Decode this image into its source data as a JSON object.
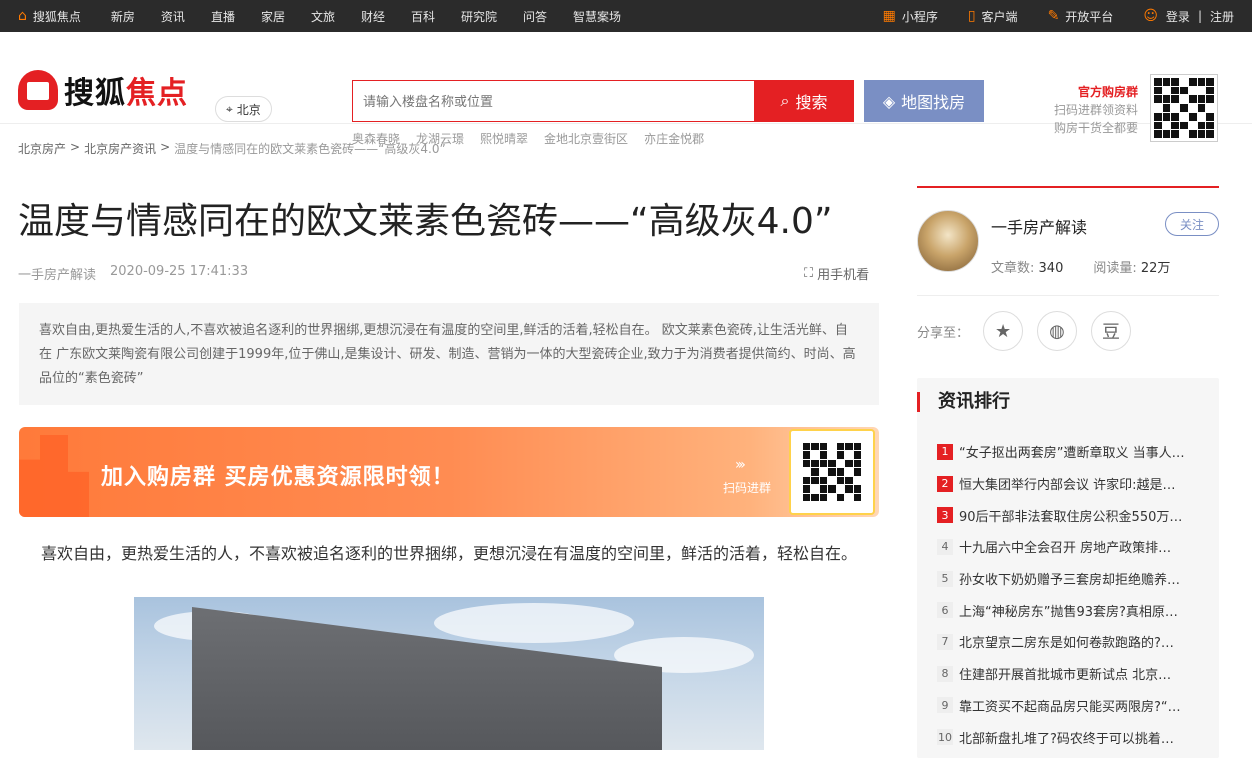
{
  "topbar": {
    "home": "搜狐焦点",
    "nav": [
      "新房",
      "资讯",
      "直播",
      "家居",
      "文旅",
      "财经",
      "百科",
      "研究院",
      "问答",
      "智慧案场"
    ],
    "mini_program": "小程序",
    "client": "客户端",
    "open_platform": "开放平台",
    "login": "登录",
    "register": "注册",
    "sep": "|"
  },
  "header": {
    "logo_a": "搜狐",
    "logo_b": "焦点",
    "city": "北京",
    "search_placeholder": "请输入楼盘名称或位置",
    "search_button": "搜索",
    "map_button": "地图找房",
    "hot_searches": [
      "奥森春晓",
      "龙湖云璟",
      "熙悦晴翠",
      "金地北京壹街区",
      "亦庄金悦郡"
    ],
    "group_title": "官方购房群",
    "group_line1": "扫码进群领资料",
    "group_line2": "购房干货全都要"
  },
  "breadcrumb": {
    "items": [
      "北京房产",
      "北京房产资讯"
    ],
    "sep": ">",
    "current": "温度与情感同在的欧文莱素色瓷砖——“高级灰4.0”"
  },
  "article": {
    "title": "温度与情感同在的欧文莱素色瓷砖——“高级灰4.0”",
    "author": "一手房产解读",
    "time": "2020-09-25 17:41:33",
    "mobile_read": "用手机看",
    "summary": "喜欢自由,更热爱生活的人,不喜欢被追名逐利的世界捆绑,更想沉浸在有温度的空间里,鲜活的活着,轻松自在。 欧文莱素色瓷砖,让生活光鲜、自在 广东欧文莱陶瓷有限公司创建于1999年,位于佛山,是集设计、研发、制造、营销为一体的大型瓷砖企业,致力于为消费者提供简约、时尚、高品位的“素色瓷砖”",
    "banner_text": "加入购房群 买房优惠资源限时领！",
    "banner_scan": "扫码进群",
    "banner_arrows": "›››",
    "lead": "喜欢自由，更热爱生活的人，不喜欢被追名逐利的世界捆绑，更想沉浸在有温度的空间里，鲜活的活着，轻松自在。"
  },
  "sidebar": {
    "author_name": "一手房产解读",
    "follow": "关注",
    "articles_label": "文章数:",
    "articles_value": "340",
    "reads_label": "阅读量:",
    "reads_value": "22万",
    "share_label": "分享至：",
    "rank_title": "资讯排行",
    "rank": [
      "“女子抠出两套房”遭断章取义 当事人…",
      "恒大集团举行内部会议 许家印:越是…",
      "90后干部非法套取住房公积金550万…",
      "十九届六中全会召开 房地产政策排…",
      "孙女收下奶奶赠予三套房却拒绝赡养…",
      "上海“神秘房东”抛售93套房?真相原…",
      "北京望京二房东是如何卷款跑路的?…",
      "住建部开展首批城市更新试点 北京…",
      "靠工资买不起商品房只能买两限房?“…",
      "北部新盘扎堆了?码农终于可以挑着…"
    ]
  },
  "colors": {
    "brand_red": "#e42023",
    "map_blue": "#7a8fc4",
    "banner_orange": "#ff7a3a"
  }
}
